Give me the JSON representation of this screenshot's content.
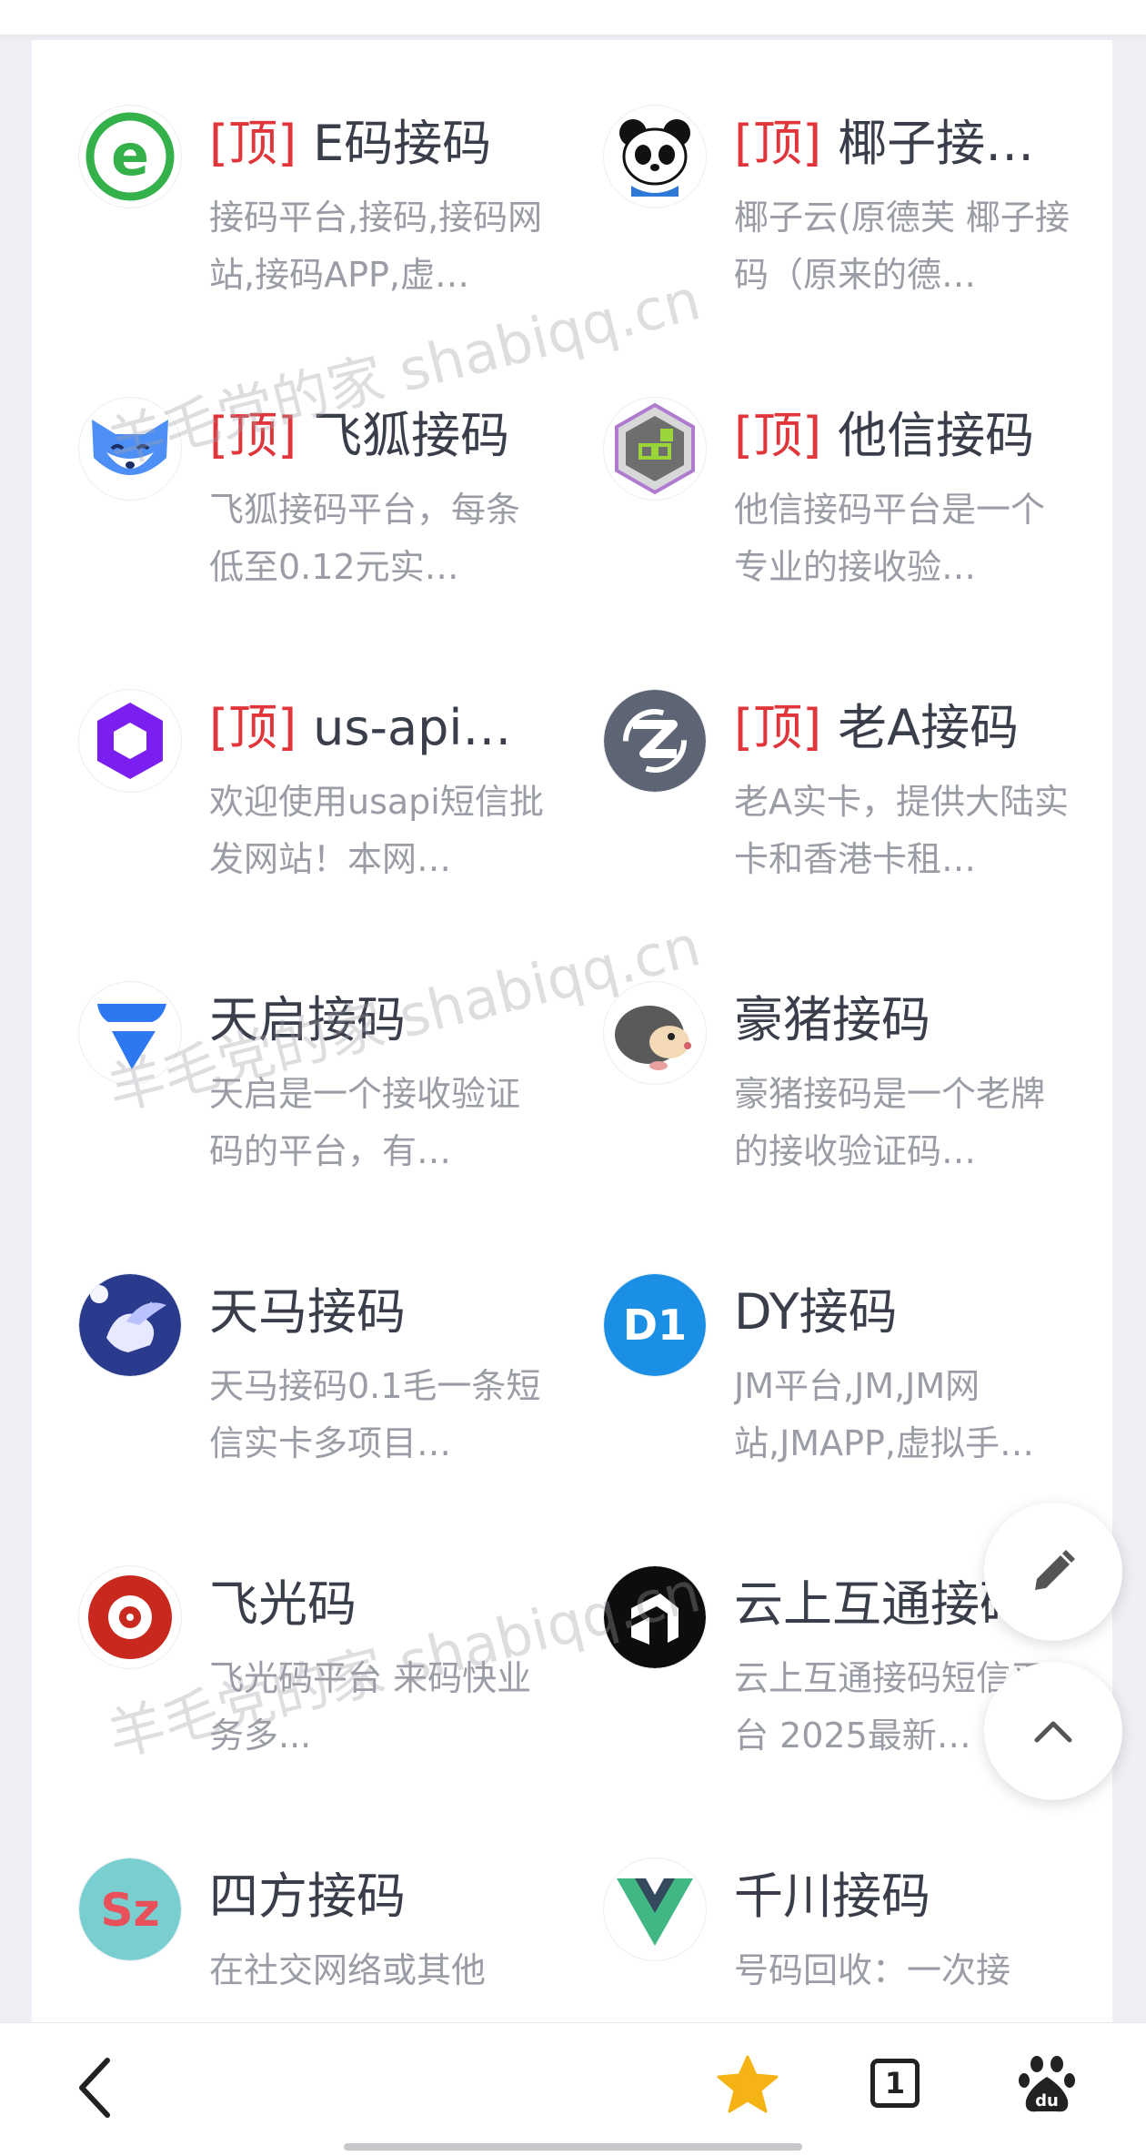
{
  "items": [
    {
      "tag": "[顶]",
      "name": "E码接码",
      "desc": "接码平台,接码,接码网站,接码APP,虚…",
      "icon": "e-logo-icon"
    },
    {
      "tag": "[顶]",
      "name": "椰子接…",
      "desc": "椰子云(原德芙 椰子接码（原来的德…",
      "icon": "panda-icon"
    },
    {
      "tag": "[顶]",
      "name": "飞狐接码",
      "desc": "飞狐接码平台，每条低至0.12元实…",
      "icon": "fox-icon"
    },
    {
      "tag": "[顶]",
      "name": "他信接码",
      "desc": "他信接码平台是一个专业的接收验…",
      "icon": "hexagon-cube-icon"
    },
    {
      "tag": "[顶]",
      "name": "us-api…",
      "desc": "欢迎使用usapi短信批发网站！本网…",
      "icon": "purple-hexagon-icon"
    },
    {
      "tag": "[顶]",
      "name": "老A接码",
      "desc": "老A实卡，提供大陆实卡和香港卡租…",
      "icon": "z-logo-icon"
    },
    {
      "tag": "",
      "name": "天启接码",
      "desc": "天启是一个接收验证码的平台，有…",
      "icon": "blue-drop-icon"
    },
    {
      "tag": "",
      "name": "豪猪接码",
      "desc": "豪猪接码是一个老牌的接收验证码…",
      "icon": "hedgehog-icon"
    },
    {
      "tag": "",
      "name": "天马接码",
      "desc": "天马接码0.1毛一条短信实卡多项目…",
      "icon": "pegasus-icon"
    },
    {
      "tag": "",
      "name": "DY接码",
      "desc": "JM平台,JM,JM网站,JMAPP,虚拟手…",
      "icon": "dy-logo-icon"
    },
    {
      "tag": "",
      "name": "飞光码",
      "desc": "飞光码平台 来码快业务多...",
      "icon": "red-emblem-icon"
    },
    {
      "tag": "",
      "name": "云上互通接码",
      "desc": "云上互通接码短信平台 2025最新…",
      "icon": "arrow-logo-icon"
    },
    {
      "tag": "",
      "name": "四方接码",
      "desc": "在社交网络或其他",
      "icon": "sz-logo-icon"
    },
    {
      "tag": "",
      "name": "千川接码",
      "desc": "号码回收：一次接",
      "icon": "v-logo-icon"
    }
  ],
  "watermark": "羊毛党的家 shabiqq.cn",
  "fab": {
    "edit_icon": "pencil-icon",
    "top_icon": "chevron-up-icon"
  },
  "bottom_nav": {
    "back_icon": "chevron-left-icon",
    "favorite_icon": "star-icon",
    "tab_count": "1",
    "baidu_icon": "paw-icon"
  },
  "colors": {
    "tag": "#e0353a",
    "star": "#f5b315",
    "title": "#3a3d4a",
    "desc": "#9a9ca6"
  }
}
